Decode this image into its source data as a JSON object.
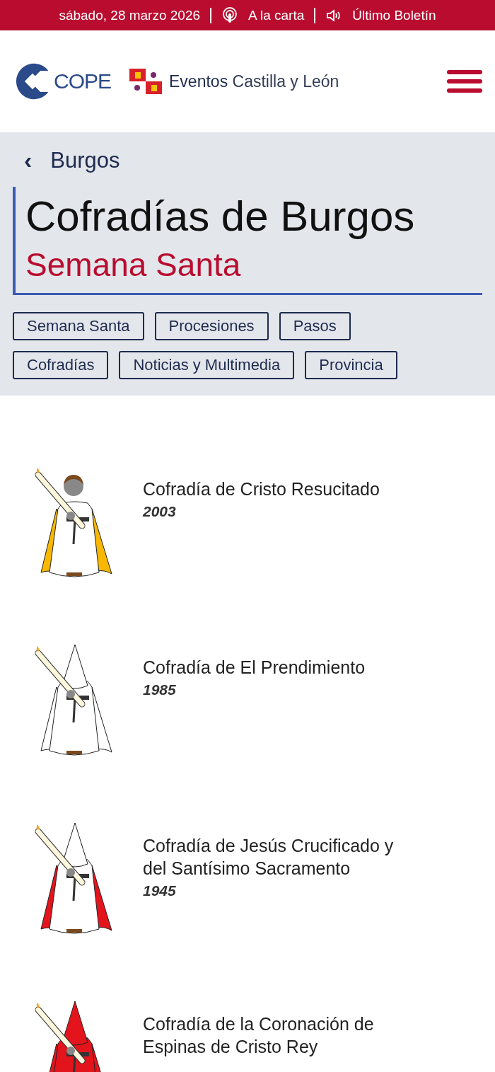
{
  "top_bar": {
    "date": "sábado, 28 marzo 2026",
    "links": [
      {
        "kind": "podcast",
        "label": "A la carta"
      },
      {
        "kind": "speaker",
        "label": "Último Boletín"
      }
    ]
  },
  "header": {
    "logo": "COPE",
    "brand_bold": "Eventos",
    "brand_light": "Castilla y León"
  },
  "breadcrumb": {
    "icon": "‹",
    "label": "Burgos"
  },
  "title": "Cofradías de Burgos",
  "subtitle": "Semana Santa",
  "tags": [
    [
      "Semana Santa",
      "Procesiones",
      "Pasos"
    ],
    [
      "Cofradías",
      "Noticias y Multimedia",
      "Provincia"
    ]
  ],
  "brotherhoods": [
    {
      "name": "Cofradía de Cristo Resucitado",
      "year": "2003",
      "kind": "bare",
      "color": "#f9b800"
    },
    {
      "name": "Cofradía de El Prendimiento",
      "year": "1985",
      "kind": "hooded"
    },
    {
      "name": "Cofradía de Jesús Crucificado y del Santísimo Sacramento",
      "year": "1945",
      "kind": "hooded",
      "color": "#e3141c"
    },
    {
      "name": "Cofradía de la Coronación de Espinas de Cristo Rey",
      "kind": "full",
      "color": "#e3141c"
    }
  ]
}
